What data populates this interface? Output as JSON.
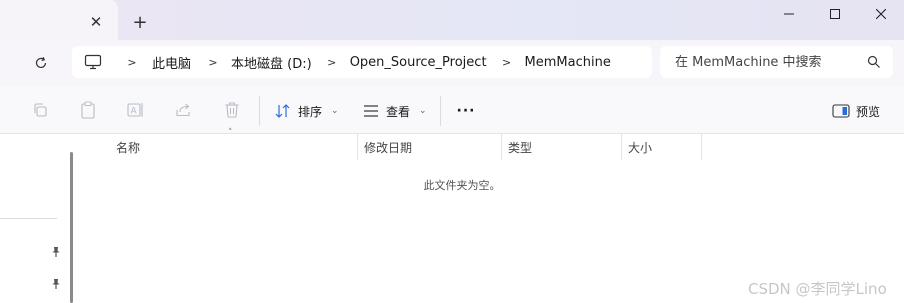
{
  "tab": {
    "close_glyph": "✕",
    "new_tab_glyph": "+"
  },
  "window_controls": {
    "minimize": "—",
    "maximize": "☐",
    "close": "✕"
  },
  "breadcrumb": [
    "此电脑",
    "本地磁盘 (D:)",
    "Open_Source_Project",
    "MemMachine"
  ],
  "breadcrumb_separator": ">",
  "search": {
    "placeholder": "在 MemMachine 中搜索"
  },
  "toolbar": {
    "sort_label": "排序",
    "view_label": "查看",
    "more_label": "···",
    "preview_label": "预览"
  },
  "columns": [
    "名称",
    "修改日期",
    "类型",
    "大小"
  ],
  "empty_message": "此文件夹为空。",
  "watermark": "CSDN @李同学Lino",
  "colors": {
    "titlebar": "#e8e5f4",
    "address_row": "#f7f5fa",
    "command_bar": "#f9f9fb",
    "accent": "#2b6cd9"
  }
}
